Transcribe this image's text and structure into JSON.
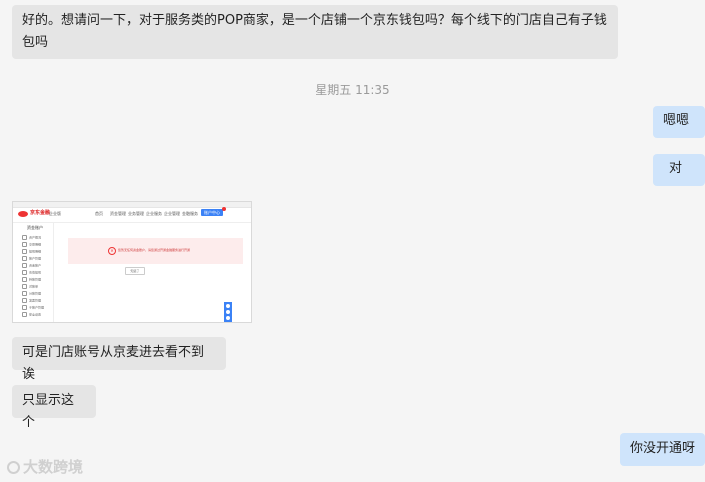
{
  "messages": [
    {
      "id": "msg-1",
      "side": "incoming",
      "text": "好的。想请问一下，对于服务类的POP商家，是一个店铺一个京东钱包吗？每个线下的门店自己有子钱包吗"
    },
    {
      "id": "msg-2",
      "side": "outgoing",
      "text": "嗯嗯"
    },
    {
      "id": "msg-3",
      "side": "outgoing",
      "text": "对"
    },
    {
      "id": "msg-5",
      "side": "incoming",
      "text": "可是门店账号从京麦进去看不到诶"
    },
    {
      "id": "msg-6",
      "side": "incoming",
      "text": "只显示这个"
    },
    {
      "id": "msg-7",
      "side": "outgoing",
      "text": "你没开通呀"
    }
  ],
  "timestamp": "星期五 11:35",
  "thumbnail": {
    "logo_text": "京东金融",
    "logo_sub": "企业版",
    "nav": [
      "首页",
      "资金管理",
      "业务管理",
      "企业服务",
      "企业管理",
      "金融服务"
    ],
    "nav_button": "账户中心",
    "sidebar_title": "资金账户",
    "sidebar_items": [
      "资产概况",
      "交易明细",
      "提现明细",
      "账户管理",
      "资金账户",
      "充值提现",
      "转账管理",
      "对账单",
      "分账管理",
      "发票管理",
      "子账户管理",
      "安全设置"
    ],
    "notice_text": "您暂无任何资金账户，请您通过开通金融服务进行开通",
    "close_button": "知道了"
  },
  "watermark": "大数跨境",
  "colors": {
    "background": "#f5f5f5",
    "incoming_bubble": "#e5e5e5",
    "outgoing_bubble": "#cfe4fb",
    "timestamp": "#9a9a9a"
  }
}
